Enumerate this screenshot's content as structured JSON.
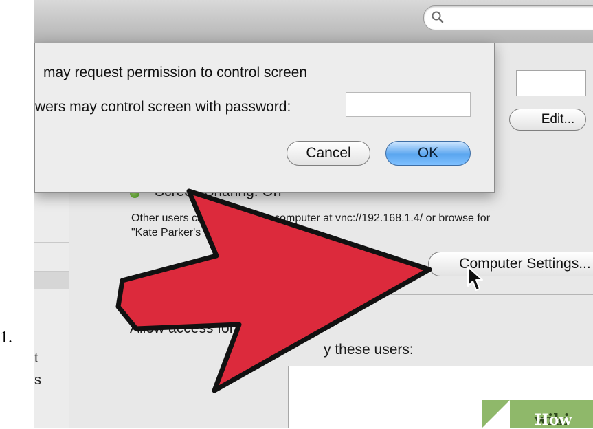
{
  "list_marker": "1.",
  "toolbar": {
    "search_icon": "search-icon"
  },
  "sidebar": {
    "fragments": [
      "t",
      "s"
    ]
  },
  "main": {
    "edit_button": "Edit...",
    "status": {
      "label": "Screen Sharing: On",
      "color": "#4aa51b"
    },
    "description_line1": "Other users can access your computer at vnc://192.168.1.4/ or browse for",
    "description_line2": "\"Kate Parker's M",
    "computer_settings_button": "Computer Settings...",
    "allow_access_label": "Allow access for:",
    "only_users_label": "y these users:"
  },
  "sheet": {
    "option1": "may request permission to control screen",
    "option2": "wers may control screen with password:",
    "password_value": "",
    "cancel_label": "Cancel",
    "ok_label": "OK"
  },
  "overlay": {
    "arrow_color": "#dc2a3c"
  },
  "watermark": {
    "part1": "wiki",
    "part2": "How"
  }
}
